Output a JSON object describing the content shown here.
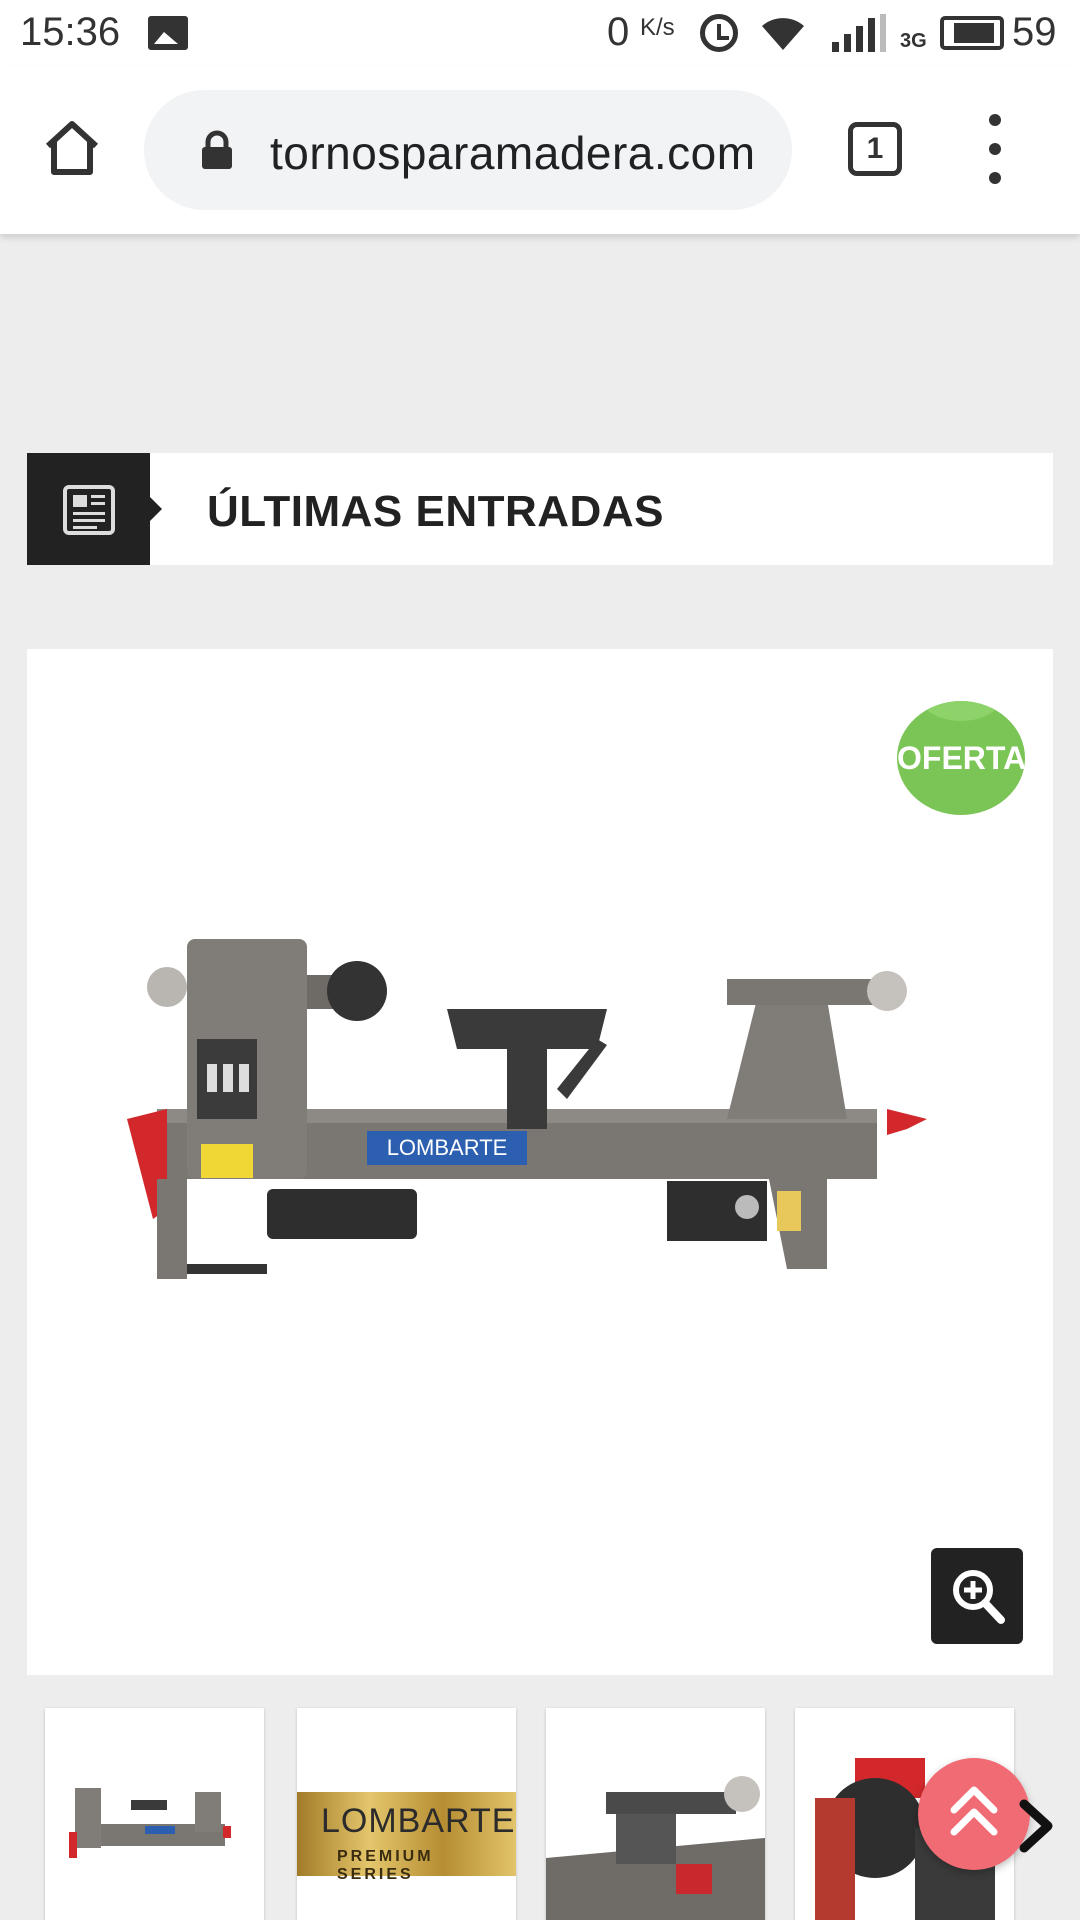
{
  "status_bar": {
    "time": "15:36",
    "net_speed": "0",
    "net_speed_unit": "K/s",
    "network_type": "3G",
    "battery": "59"
  },
  "browser": {
    "url": "tornosparamadera.com",
    "tab_count": "1"
  },
  "section": {
    "title": "ÚLTIMAS ENTRADAS",
    "icon": "newspaper-icon"
  },
  "product": {
    "badge": "OFERTA!",
    "image_brand": "LOMBARTE",
    "zoom_icon": "zoom-in-icon"
  },
  "thumbnails": {
    "logo_text": "LOMBARTE",
    "logo_subtext": "PREMIUM SERIES"
  },
  "colors": {
    "badge": "#7ac555",
    "scroll_top_button": "#f06b73",
    "header_icon_bg": "#222222",
    "page_bg": "#ededed"
  }
}
